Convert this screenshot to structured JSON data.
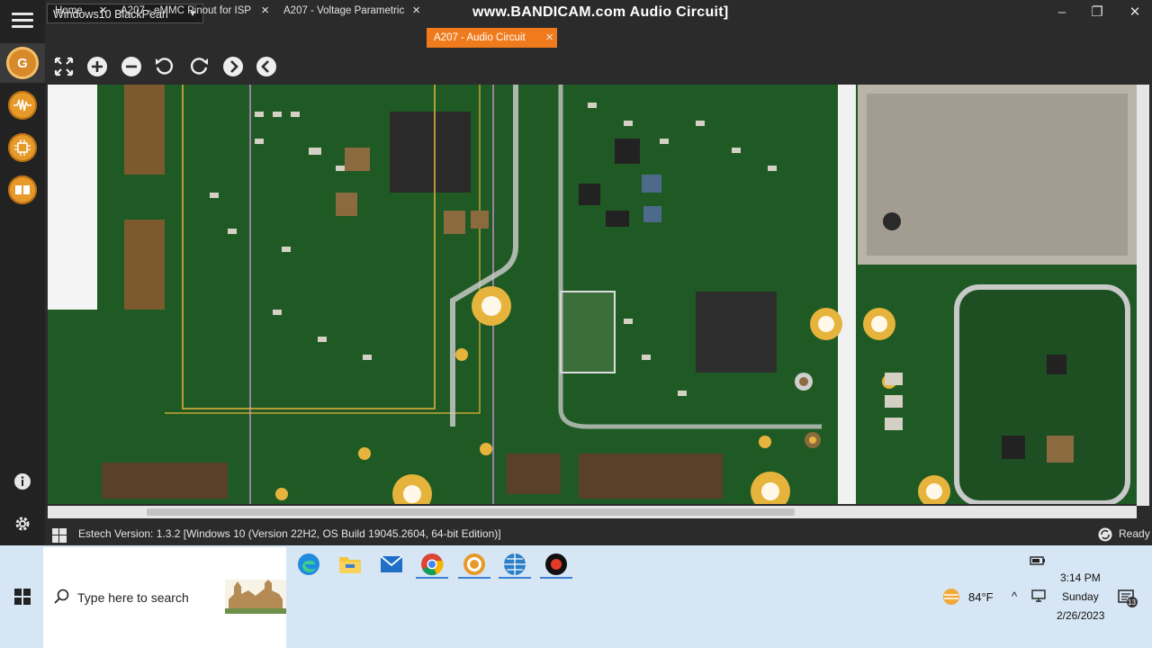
{
  "window": {
    "selector_value": "Windows10 BlackPearl",
    "title": "www.BANDICAM.com Audio Circuit]",
    "controls": [
      "minimize",
      "maximize",
      "close"
    ]
  },
  "tabs": [
    {
      "label": "Home",
      "active": false
    },
    {
      "label": "A207 - eMMC Pinout for ISP",
      "active": false
    },
    {
      "label": "A207 - Voltage Parametric",
      "active": false
    },
    {
      "label": "A207 - Audio Circuit",
      "active": true
    }
  ],
  "tab_close_glyph": "×",
  "toolbar": [
    "fit-screen-icon",
    "zoom-in-icon",
    "zoom-out-icon",
    "rotate-left-icon",
    "rotate-right-icon",
    "next-icon",
    "previous-icon"
  ],
  "sidebar": {
    "items": [
      "logo-icon",
      "waveform-icon",
      "circuit-icon",
      "parts-icon"
    ],
    "bottom": [
      "info-icon",
      "settings-icon"
    ]
  },
  "status": {
    "version": "Estech Version: 1.3.2 [Windows 10 (Version 22H2, OS Build 19045.2604, 64-bit Edition)]",
    "state": "Ready"
  },
  "taskbar": {
    "search_placeholder": "Type here to search",
    "apps": [
      "edge-icon",
      "file-explorer-icon",
      "mail-icon",
      "chrome-icon",
      "app-circle-icon",
      "app-globe-icon",
      "record-icon"
    ],
    "weather": "84°F",
    "time": "3:14 PM",
    "day": "Sunday",
    "date": "2/26/2023",
    "notifications": "13"
  },
  "colors": {
    "accent": "#f07b1d",
    "pcb_green": "#1f5a24",
    "pad_gold": "#e6b43c"
  }
}
